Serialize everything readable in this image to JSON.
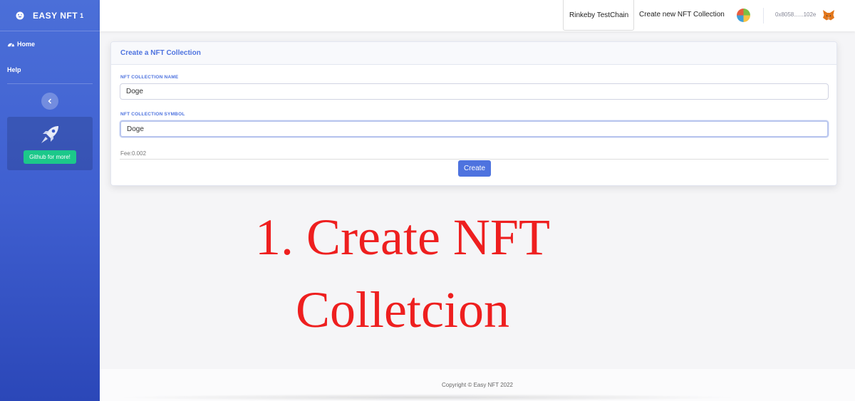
{
  "sidebar": {
    "brand": "EASY NFT",
    "brand_sup": "1",
    "items": [
      {
        "label": "Home"
      },
      {
        "label": "Help"
      }
    ],
    "promo_button": "Github for more!"
  },
  "topbar": {
    "network": "Rinkeby TestChain",
    "create_link": "Create new NFT Collection",
    "address": "0x8058......102e"
  },
  "card": {
    "title": "Create a NFT Collection",
    "name_label": "NFT COLLECTION NAME",
    "name_value": "Doge",
    "symbol_label": "NFT COLLECTION SYMBOL",
    "symbol_value": "Doge",
    "fee": "Fee:0.002",
    "create_button": "Create"
  },
  "annotation": {
    "line1": "1. Create NFT",
    "line2": "Colletcion"
  },
  "footer": {
    "copyright": "Copyright © Easy NFT 2022"
  },
  "colors": {
    "accent": "#4e73df",
    "success": "#1cc88a",
    "annotation": "#ee1f1f"
  }
}
